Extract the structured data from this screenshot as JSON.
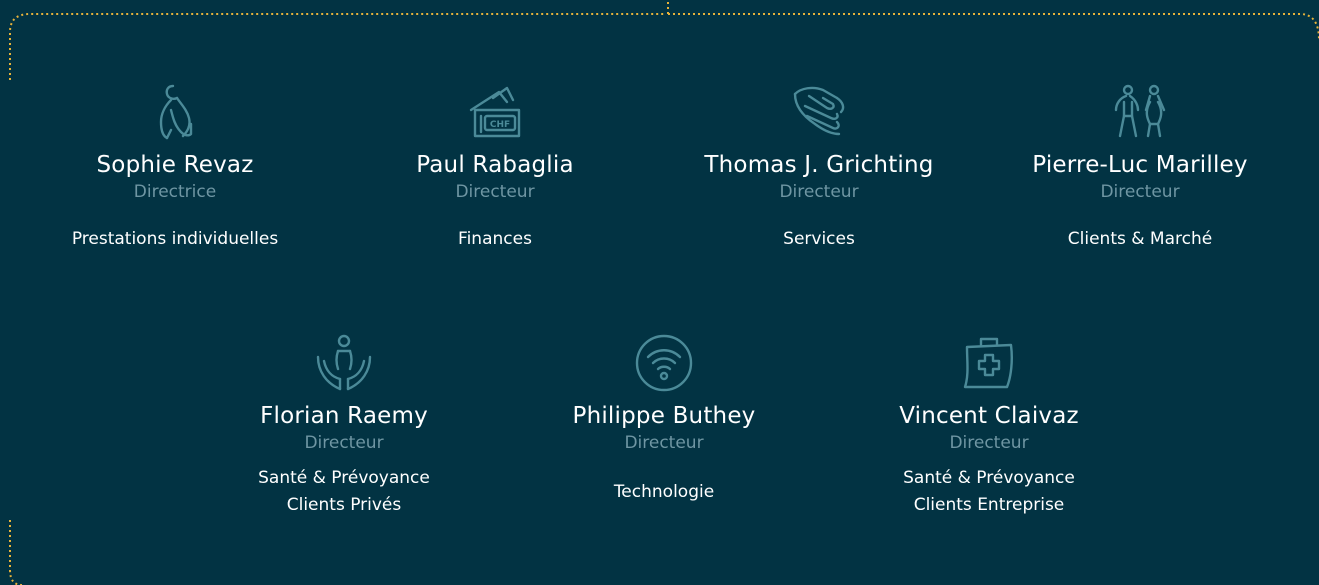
{
  "colors": {
    "background": "#023343",
    "accent_border": "#e6b23a",
    "icon_stroke": "#4b8a98",
    "role_text": "#6f96a3",
    "text": "#ffffff"
  },
  "members": [
    {
      "name": "Sophie Revaz",
      "role": "Directrice",
      "dept": [
        "Prestations individuelles"
      ],
      "icon": "person-pregnant-icon"
    },
    {
      "name": "Paul Rabaglia",
      "role": "Directeur",
      "dept": [
        "Finances"
      ],
      "icon": "chf-wallet-icon"
    },
    {
      "name": "Thomas J. Grichting",
      "role": "Directeur",
      "dept": [
        "Services"
      ],
      "icon": "helping-hands-icon"
    },
    {
      "name": "Pierre-Luc Marilley",
      "role": "Directeur",
      "dept": [
        "Clients & Marché"
      ],
      "icon": "people-walking-icon"
    },
    {
      "name": "Florian Raemy",
      "role": "Directeur",
      "dept": [
        "Santé & Prévoyance",
        "Clients Privés"
      ],
      "icon": "person-cared-hands-icon"
    },
    {
      "name": "Philippe Buthey",
      "role": "Directeur",
      "dept": [
        "Technologie"
      ],
      "icon": "wifi-icon"
    },
    {
      "name": "Vincent Claivaz",
      "role": "Directeur",
      "dept": [
        "Santé & Prévoyance",
        "Clients Entreprise"
      ],
      "icon": "medical-kit-icon"
    }
  ]
}
